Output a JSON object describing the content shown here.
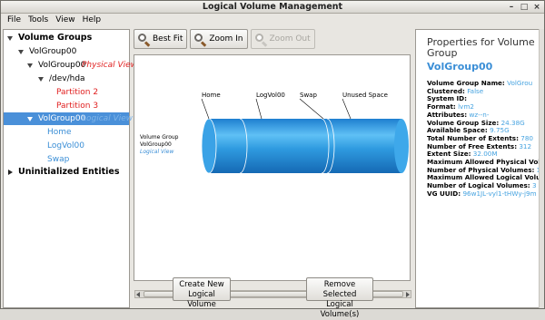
{
  "window": {
    "title": "Logical Volume Management",
    "controls": [
      "–",
      "□",
      "×"
    ]
  },
  "menu": [
    "File",
    "Tools",
    "View",
    "Help"
  ],
  "tree": {
    "volume_groups": "Volume Groups",
    "vg1": "VolGroup00",
    "vg1_physical": "VolGroup00",
    "vg1_physical_tag": "Physical View",
    "dev": "/dev/hda",
    "part2": "Partition 2",
    "part3": "Partition 3",
    "vg1_logical": "VolGroup00",
    "vg1_logical_tag": "Logical View",
    "home": "Home",
    "logvol": "LogVol00",
    "swap": "Swap",
    "uninit": "Uninitialized Entities"
  },
  "toolbar": {
    "best_fit": "Best Fit",
    "zoom_in": "Zoom In",
    "zoom_out": "Zoom Out"
  },
  "diagram": {
    "vg_label": [
      "Volume Group",
      "VolGroup00"
    ],
    "view_label": "Logical View",
    "segments": [
      "Home",
      "LogVol00",
      "Swap",
      "Unused Space"
    ]
  },
  "buttons": {
    "create": [
      "Create New",
      "Logical Volume"
    ],
    "remove": [
      "Remove Selected",
      "Logical Volume(s)"
    ]
  },
  "properties": {
    "heading": "Properties for Volume Group",
    "name": "VolGroup00",
    "rows": [
      {
        "label": "Volume Group Name:",
        "value": "VolGrou"
      },
      {
        "label": "Clustered:",
        "value": "False"
      },
      {
        "label": "System ID:",
        "value": ""
      },
      {
        "label": "Format:",
        "value": "lvm2"
      },
      {
        "label": "Attributes:",
        "value": "wz--n-"
      },
      {
        "label": "Volume Group Size:",
        "value": "24.38G"
      },
      {
        "label": "Available Space:",
        "value": "9.75G"
      },
      {
        "label": "Total Number of Extents:",
        "value": "780"
      },
      {
        "label": "Number of Free Extents:",
        "value": "312"
      },
      {
        "label": "Extent Size:",
        "value": "32.00M"
      },
      {
        "label": "Maximum Allowed Physical Volu",
        "value": ""
      },
      {
        "label": "Number of Physical Volumes:",
        "value": "1"
      },
      {
        "label": "Maximum Allowed Logical Volu",
        "value": ""
      },
      {
        "label": "Number of Logical Volumes:",
        "value": "3"
      },
      {
        "label": "VG UUID:",
        "value": "96w1JL-vyl1-tHWy-j9m"
      }
    ]
  },
  "colors": {
    "selection": "#4a90d9",
    "accent_blue": "#3a8ed6",
    "red_tag": "#e02020",
    "cylinder": "#2f9be0"
  }
}
